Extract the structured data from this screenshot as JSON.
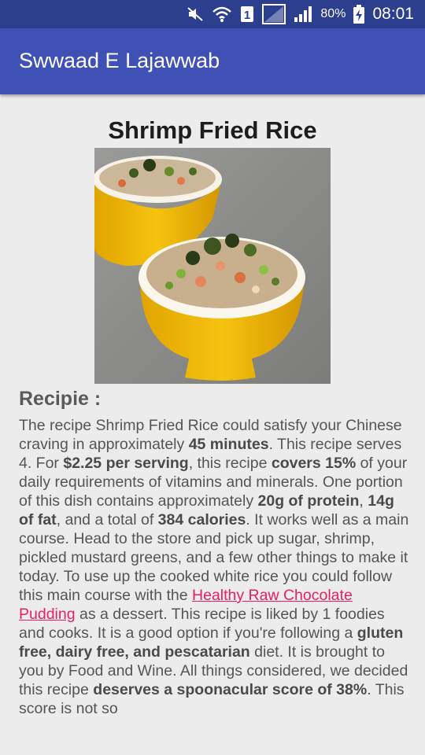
{
  "status_bar": {
    "battery_percent": "80%",
    "time": "08:01",
    "icons": [
      "mute-icon",
      "wifi-icon",
      "sim-1-icon",
      "no-signal-icon",
      "signal-icon",
      "battery-charging-icon"
    ]
  },
  "app_bar": {
    "title": "Swwaad E Lajawwab",
    "color": "#3f51b5"
  },
  "recipe": {
    "title": "Shrimp Fried Rice",
    "image_icon": "shrimp-fried-rice-photo",
    "section_heading": "Recipie :",
    "body": {
      "s1": "The recipe Shrimp Fried Rice could satisfy your Chinese craving in approximately ",
      "b1": "45 minutes",
      "s2": ". This recipe serves 4. For ",
      "b2": "$2.25 per serving",
      "s3": ", this recipe ",
      "b3": "covers 15%",
      "s4": " of your daily requirements of vitamins and minerals. One portion of this dish contains approximately ",
      "b4": "20g of protein",
      "s5": ", ",
      "b5": "14g of fat",
      "s6": ", and a total of ",
      "b6": "384 calories",
      "s7": ". It works well as a main course. Head to the store and pick up sugar, shrimp, pickled mustard greens, and a few other things to make it today. To use up the cooked white rice you could follow this main course with the ",
      "link": "Healthy Raw Chocolate Pudding",
      "s8": " as a dessert. This recipe is liked by 1 foodies and cooks. It is a good option if you're following a ",
      "b7": "gluten free, dairy free, and pescatarian",
      "s9": " diet. It is brought to you by Food and Wine. All things considered, we decided this recipe ",
      "b8": "deserves a spoonacular score of 38%",
      "s10": ". This score is not so"
    }
  }
}
